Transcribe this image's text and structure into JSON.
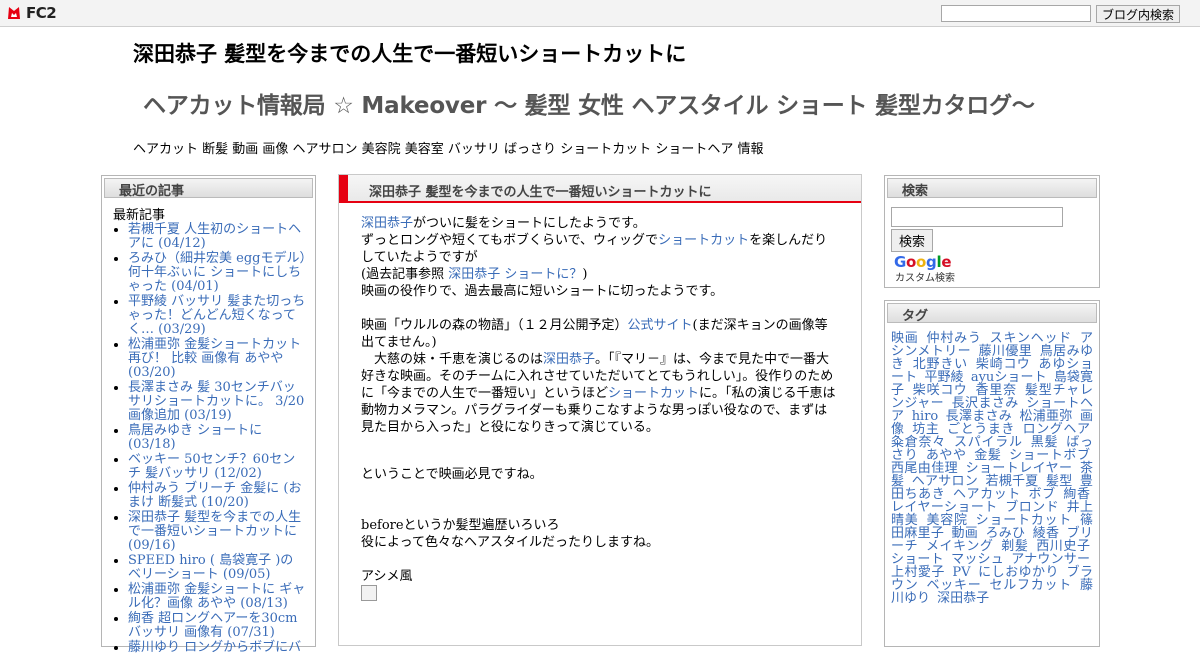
{
  "fc2bar": {
    "logo_text": "FC2",
    "search_value": "",
    "search_button": "ブログ内検索"
  },
  "header": {
    "title": "深田恭子 髪型を今までの人生で一番短いショートカットに",
    "blog_name": "ヘアカット情報局 ☆ Makeover ～ 髪型 女性 ヘアスタイル ショート 髪型カタログ～",
    "description": "ヘアカット 断髪 動画 画像 ヘアサロン 美容院 美容室 バッサリ ばっさり ショートカット ショートヘア 情報"
  },
  "recent": {
    "heading": "最近の記事",
    "sub": "最新記事",
    "items": [
      "若槻千夏 人生初のショートヘアに (04/12)",
      "ろみひ（細井宏美 eggモデル）何十年ぶぃに ショートにしちゃった (04/01)",
      "平野綾 バッサリ 髪また切っちゃった！どんどん短くなってく… (03/29)",
      "松浦亜弥 金髪ショートカット 再び！ 比較 画像有 あやや (03/20)",
      "長澤まさみ 髪 30センチバッサリショートカットに。 3/20画像追加 (03/19)",
      "鳥居みゆき ショートに (03/18)",
      "ベッキー 50センチ？60センチ 髪バッサリ (12/02)",
      "仲村みう ブリーチ 金髪に (おまけ 断髪式 (10/20)",
      "深田恭子 髪型を今までの人生で一番短いショートカットに (09/16)",
      "SPEED hiro ( 島袋寛子 )の ベリーショート (09/05)",
      "松浦亜弥 金髪ショートに ギャル化？画像 あやや (08/13)",
      "絢香 超ロングヘアーを30cmバッサリ 画像有 (07/31)",
      "藤川ゆり ロングからボブにバ"
    ]
  },
  "post": {
    "title": "深田恭子 髪型を今までの人生で一番短いショートカットに",
    "p1_link1": "深田恭子",
    "p1_t1": "がついに髪をショートにしたようです。",
    "p1_t2": "ずっとロングや短くてもボブくらいで、ウィッグで",
    "p1_link2": "ショートカット",
    "p1_t3": "を楽しんだりしていたようですが",
    "p1_t4": "(過去記事参照 ",
    "p1_link3": "深田恭子 ショートに？",
    "p1_t5": ")",
    "p1_t6": "映画の役作りで、過去最高に短いショートに切ったようです。",
    "p2_t1": "映画「ウルルの森の物語」（１２月公開予定）",
    "p2_link": "公式サイト",
    "p2_t2": "(まだ深キョンの画像等出てません。)",
    "q_t1": "　大慈の妹・千恵を演じるのは",
    "q_link1": "深田恭子",
    "q_t2": "。「『マリ－』は、今まで見た中で一番大好きな映画。そのチームに入れさせていただいてとてもうれしい」。役作りのために「今までの人生で一番短い」というほど",
    "q_link2": "ショートカット",
    "q_t3": "に。「私の演じる千恵は動物カメラマン。パラグライダーも乗りこなすような男っぽい役なので、まずは見た目から入った」と役になりきって演じている。",
    "p3": "ということで映画必見ですね。",
    "p4_1": "beforeというか髪型遍歴いろいろ",
    "p4_2": "役によって色々なヘアスタイルだったりしますね。",
    "p5": "アシメ風"
  },
  "search": {
    "heading": "検索",
    "button": "検索",
    "google": "Google",
    "custom": "カスタム検索"
  },
  "tags": {
    "heading": "タグ",
    "items": [
      "映画",
      "仲村みう",
      "スキンヘッド",
      "アシンメトリー",
      "藤川優里",
      "鳥居みゆき",
      "北野きい",
      "柴崎コウ",
      "あゆショート",
      "平野綾",
      "ayuショート",
      "島袋寛子",
      "柴咲コウ",
      "香里奈",
      "髪型チャレンジャー",
      "長沢まさみ",
      "ショートヘア",
      "hiro",
      "長澤まさみ",
      "松浦亜弥",
      "画像",
      "坊主",
      "ごとうまき",
      "ロングヘア",
      "粂倉奈々",
      "スパイラル",
      "黒髪",
      "ばっさり",
      "あやや",
      "金髪",
      "ショートボブ",
      "西尾由佳理",
      "ショートレイヤー",
      "茶髪",
      "ヘアサロン",
      "若槻千夏",
      "髪型",
      "豊田ちあき",
      "ヘアカット",
      "ボブ",
      "絢香",
      "レイヤーショート",
      "ブロンド",
      "井上晴美",
      "美容院",
      "ショートカット",
      "篠田麻里子",
      "動画",
      "ろみひ",
      "綾香",
      "ブリーチ",
      "メイキング",
      "剃髪",
      "西川史子",
      "ショート",
      "マッシュ",
      "アナウンサー",
      "上村愛子",
      "PV",
      "にしおゆかり",
      "ブラウン",
      "ベッキー",
      "セルフカット",
      "藤川ゆり",
      "深田恭子"
    ]
  },
  "colors": {
    "link": "#3a6cb8",
    "accent": "#e60012"
  }
}
